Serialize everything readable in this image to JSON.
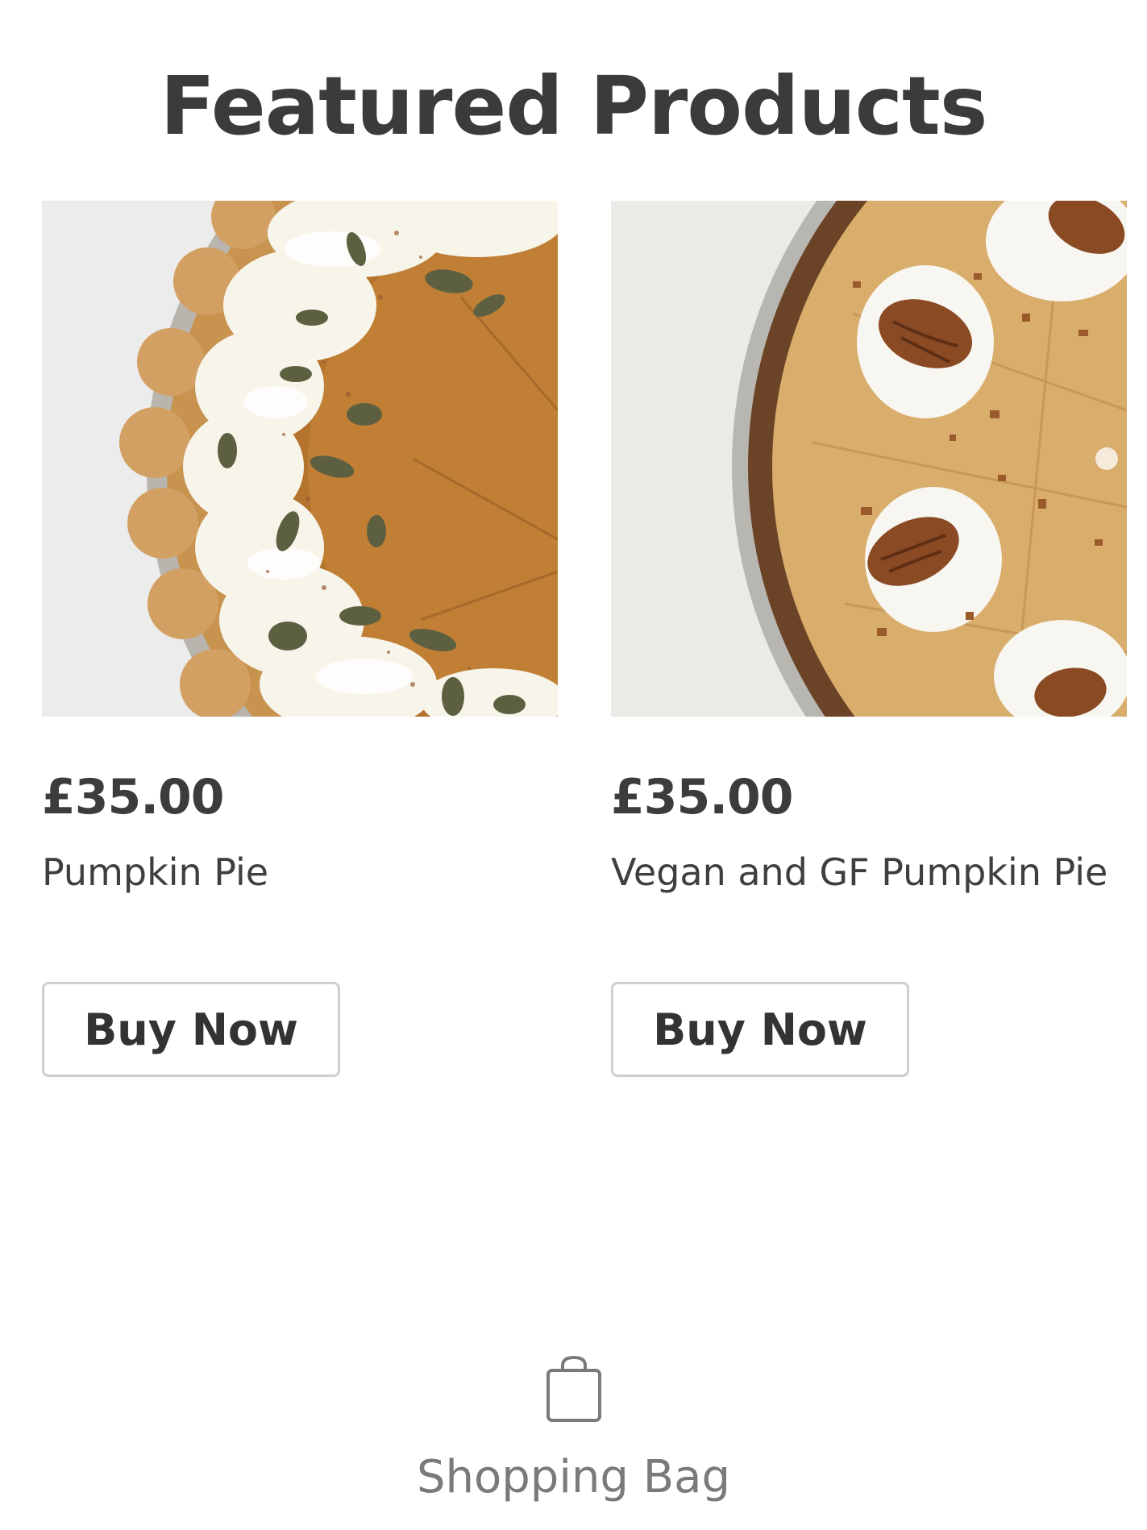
{
  "header": {
    "title": "Featured Products"
  },
  "products": [
    {
      "image_icon": "pumpkin-pie-photo",
      "price": "£35.00",
      "name": "Pumpkin Pie",
      "button_label": "Buy Now"
    },
    {
      "image_icon": "vegan-gf-pumpkin-pie-photo",
      "price": "£35.00",
      "name": "Vegan and GF Pumpkin Pie",
      "button_label": "Buy Now"
    }
  ],
  "footer": {
    "bag_icon": "shopping-bag-icon",
    "bag_label": "Shopping Bag"
  },
  "colors": {
    "text": "#3b3b3b",
    "muted": "#7a7a7a",
    "button_border": "#cfcfcf"
  }
}
